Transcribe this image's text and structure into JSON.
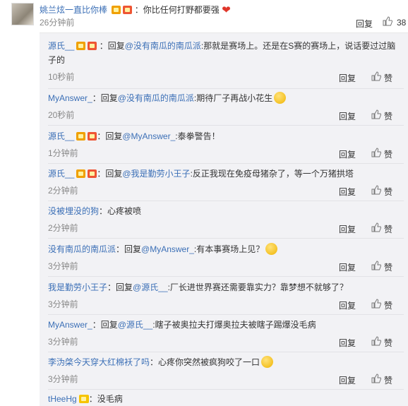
{
  "top_comment": {
    "user": "姚兰炫一直比你棒",
    "text": "：你比任何打野都要强",
    "time": "26分钟前",
    "reply_label": "回复",
    "likes": "38"
  },
  "replies": [
    {
      "user": "源氏__",
      "reply_prefix": "：回复",
      "target": "@没有南瓜的南瓜派",
      "text": ":那就是赛场上。还是在S赛的赛场上，说话要过过脑子的",
      "time": "10秒前",
      "reply_label": "回复",
      "like_label": "赞"
    },
    {
      "user": "MyAnswer_",
      "reply_prefix": "：回复",
      "target": "@没有南瓜的南瓜派",
      "text": ":期待厂子再战小花生",
      "time": "20秒前",
      "reply_label": "回复",
      "like_label": "赞"
    },
    {
      "user": "源氏__",
      "reply_prefix": "：回复",
      "target": "@MyAnswer_",
      "text": ":泰拳警告！",
      "time": "1分钟前",
      "reply_label": "回复",
      "like_label": "赞"
    },
    {
      "user": "源氏__",
      "reply_prefix": "：回复",
      "target": "@我是勤劳小王子",
      "text": ":反正我现在免疫母猪杂了，等一个万猪拱塔",
      "time": "2分钟前",
      "reply_label": "回复",
      "like_label": "赞"
    },
    {
      "user": "没被埋没的狗",
      "reply_prefix": "",
      "target": "",
      "text": "：心疼被喷",
      "time": "2分钟前",
      "reply_label": "回复",
      "like_label": "赞"
    },
    {
      "user": "没有南瓜的南瓜派",
      "reply_prefix": "：回复",
      "target": "@MyAnswer_",
      "text": ":有本事赛场上见？",
      "time": "3分钟前",
      "reply_label": "回复",
      "like_label": "赞"
    },
    {
      "user": "我是勤劳小王子",
      "reply_prefix": "：回复",
      "target": "@源氏__",
      "text": ":厂长进世界赛还需要靠实力？靠梦想不就够了？",
      "time": "3分钟前",
      "reply_label": "回复",
      "like_label": "赞"
    },
    {
      "user": "MyAnswer_",
      "reply_prefix": "：回复",
      "target": "@源氏__",
      "text": ":瞎子被奥拉夫打爆奥拉夫被瞎子踢爆没毛病",
      "time": "3分钟前",
      "reply_label": "回复",
      "like_label": "赞"
    },
    {
      "user": "李沩棨今天穿大红棉袄了吗",
      "reply_prefix": "",
      "target": "",
      "text": "：心疼你突然被疯狗咬了一口",
      "time": "3分钟前",
      "reply_label": "回复",
      "like_label": "赞"
    },
    {
      "user": "tHeeHg",
      "reply_prefix": "",
      "target": "",
      "text": "：没毛病",
      "time": "",
      "reply_label": "",
      "like_label": ""
    }
  ],
  "icons": {
    "like": "thumbs-up-icon",
    "vip": "vip-badge-icon",
    "emoji": "smile-emoji-icon",
    "heart": "heart-emoji-icon"
  }
}
